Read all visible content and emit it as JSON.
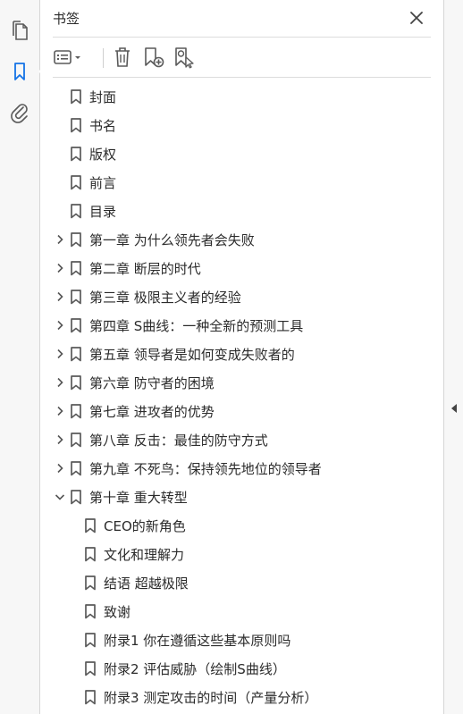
{
  "panel": {
    "title": "书签"
  },
  "rail": {
    "items": [
      "pages-icon",
      "bookmark-icon",
      "attachment-icon"
    ]
  },
  "toolbar": {
    "buttons": [
      "options-menu",
      "delete",
      "new-bookmark",
      "bookmark-from-selection"
    ]
  },
  "bookmarks": [
    {
      "label": "封面",
      "level": 0,
      "toggle": "none"
    },
    {
      "label": "书名",
      "level": 0,
      "toggle": "none"
    },
    {
      "label": "版权",
      "level": 0,
      "toggle": "none"
    },
    {
      "label": "前言",
      "level": 0,
      "toggle": "none"
    },
    {
      "label": "目录",
      "level": 0,
      "toggle": "none"
    },
    {
      "label": "第一章  为什么领先者会失败",
      "level": 0,
      "toggle": "collapsed"
    },
    {
      "label": "第二章  断层的时代",
      "level": 0,
      "toggle": "collapsed"
    },
    {
      "label": "第三章  极限主义者的经验",
      "level": 0,
      "toggle": "collapsed"
    },
    {
      "label": "第四章  S曲线：一种全新的预测工具",
      "level": 0,
      "toggle": "collapsed"
    },
    {
      "label": "第五章  领导者是如何变成失败者的",
      "level": 0,
      "toggle": "collapsed"
    },
    {
      "label": "第六章  防守者的困境",
      "level": 0,
      "toggle": "collapsed"
    },
    {
      "label": "第七章  进攻者的优势",
      "level": 0,
      "toggle": "collapsed"
    },
    {
      "label": "第八章  反击：最佳的防守方式",
      "level": 0,
      "toggle": "collapsed"
    },
    {
      "label": "第九章  不死鸟：保持领先地位的领导者",
      "level": 0,
      "toggle": "collapsed"
    },
    {
      "label": "第十章  重大转型",
      "level": 0,
      "toggle": "expanded"
    },
    {
      "label": "CEO的新角色",
      "level": 1,
      "toggle": "none"
    },
    {
      "label": "文化和理解力",
      "level": 1,
      "toggle": "none"
    },
    {
      "label": "结语  超越极限",
      "level": 1,
      "toggle": "none"
    },
    {
      "label": "致谢",
      "level": 1,
      "toggle": "none"
    },
    {
      "label": "附录1  你在遵循这些基本原则吗",
      "level": 1,
      "toggle": "none"
    },
    {
      "label": "附录2  评估威胁（绘制S曲线）",
      "level": 1,
      "toggle": "none"
    },
    {
      "label": "附录3  测定攻击的时间（产量分析）",
      "level": 1,
      "toggle": "none"
    }
  ],
  "colors": {
    "icon": "#5a5a5a",
    "accent": "#1473e6",
    "text": "#2b2b2b"
  }
}
